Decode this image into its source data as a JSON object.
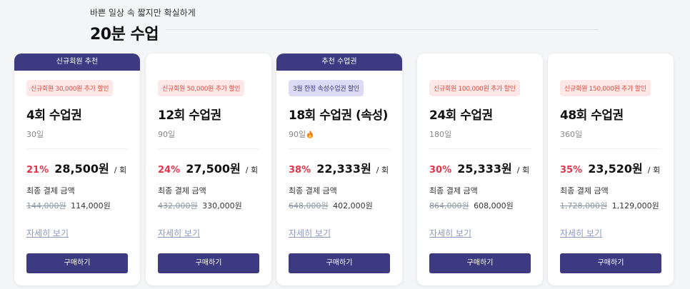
{
  "header": {
    "subtitle": "바쁜 일상 속 짧지만 확실하게",
    "title": "20분 수업"
  },
  "plans": [
    {
      "banner": "신규회원 추천",
      "promo": "신규회원 30,000원 추가 할인",
      "name": "4회 수업권",
      "duration": "30일",
      "discount": "21%",
      "unit_price": "28,500원",
      "per": "/ 회",
      "final_label": "최종 결제 금액",
      "original_price": "144,000원",
      "final_price": "114,000원",
      "detail_link": "자세히 보기",
      "buy_label": "구매하기"
    },
    {
      "promo": "신규회원 50,000원 추가 할인",
      "name": "12회 수업권",
      "duration": "90일",
      "discount": "24%",
      "unit_price": "27,500원",
      "per": "/ 회",
      "final_label": "최종 결제 금액",
      "original_price": "432,000원",
      "final_price": "330,000원",
      "detail_link": "자세히 보기",
      "buy_label": "구매하기"
    },
    {
      "banner": "추천 수업권",
      "promo": "3월 한정 속성수업권 할인",
      "name": "18회 수업권 (속성)",
      "duration": "90일",
      "duration_icon": "fire-icon",
      "discount": "38%",
      "unit_price": "22,333원",
      "per": "/ 회",
      "final_label": "최종 결제 금액",
      "original_price": "648,000원",
      "final_price": "402,000원",
      "detail_link": "자세히 보기",
      "buy_label": "구매하기"
    },
    {
      "promo": "신규회원 100,000원 추가 할인",
      "name": "24회 수업권",
      "duration": "180일",
      "discount": "30%",
      "unit_price": "25,333원",
      "per": "/ 회",
      "final_label": "최종 결제 금액",
      "original_price": "864,000원",
      "final_price": "608,000원",
      "detail_link": "자세히 보기",
      "buy_label": "구매하기"
    },
    {
      "promo": "신규회원 150,000원 추가 할인",
      "name": "48회 수업권",
      "duration": "360일",
      "discount": "35%",
      "unit_price": "23,520원",
      "per": "/ 회",
      "final_label": "최종 결제 금액",
      "original_price": "1,728,000원",
      "final_price": "1,129,000원",
      "detail_link": "자세히 보기",
      "buy_label": "구매하기"
    }
  ],
  "colors": {
    "brand": "#3e3a82",
    "discount": "#e8334a",
    "promo_bg": "#fde8e7",
    "promo_text": "#e24c3f",
    "promo_purple_bg": "#dcdaf5"
  }
}
